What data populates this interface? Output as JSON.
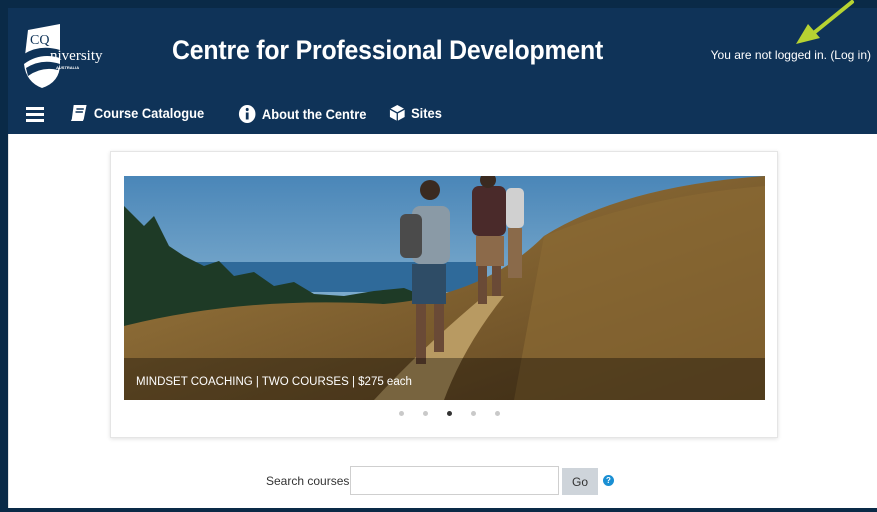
{
  "logo": {
    "text_cq": "CQ",
    "text_university": "University",
    "text_country": "AUSTRALIA"
  },
  "header": {
    "title": "Centre for Professional Development",
    "login_prefix": "You are not logged in. ",
    "login_link": "(Log in)"
  },
  "nav": {
    "items": [
      {
        "label": "Course Catalogue",
        "icon": "book-icon"
      },
      {
        "label": "About the Centre",
        "icon": "info-icon"
      },
      {
        "label": "Sites",
        "icon": "cube-icon"
      }
    ]
  },
  "carousel": {
    "caption": "MINDSET COACHING | TWO COURSES | $275 each",
    "slide_count": 5,
    "active_index": 2
  },
  "search": {
    "label": "Search courses",
    "value": "",
    "button": "Go"
  },
  "colors": {
    "header_bg": "#0f3358",
    "annotation_arrow": "#b7d332",
    "help_icon": "#1a8fd3"
  }
}
